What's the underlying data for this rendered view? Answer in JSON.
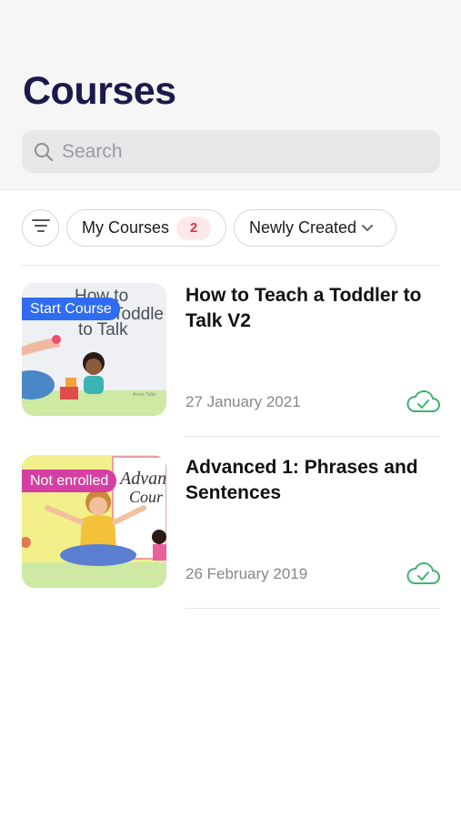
{
  "header": {
    "title": "Courses"
  },
  "search": {
    "placeholder": "Search",
    "value": ""
  },
  "filters": {
    "filter_icon": "filter-lines-icon",
    "my_courses": {
      "label": "My Courses",
      "count": "2"
    },
    "sort": {
      "label": "Newly Created",
      "icon": "chevron-down-icon"
    }
  },
  "courses": [
    {
      "title": "How to Teach a Toddler to Talk V2",
      "date": "27 January 2021",
      "badge": "Start Course",
      "badge_color": "#2f6cf0",
      "thumb_text_1": "How to",
      "thumb_text_2": "Toddle",
      "thumb_text_3": "to Talk",
      "status_icon": "cloud-check-icon"
    },
    {
      "title": "Advanced 1: Phrases and Sentences",
      "date": "26 February 2019",
      "badge": "Not enrolled",
      "badge_color": "#d63fa2",
      "thumb_text_1": "Advan",
      "thumb_text_2": "Cour",
      "status_icon": "cloud-check-icon"
    }
  ],
  "colors": {
    "title": "#1b1a4a",
    "accent_green": "#3db46d",
    "badge_red": "#e0343f"
  }
}
